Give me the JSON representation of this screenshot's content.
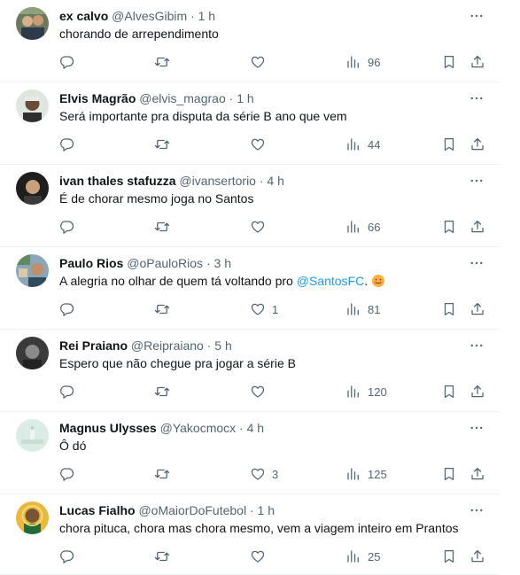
{
  "tweets": [
    {
      "name": "ex calvo",
      "handle": "@AlvesGibim",
      "time": "1 h",
      "text": "chorando de arrependimento",
      "mention": "",
      "text_after": "",
      "has_emoji": false,
      "replies": "",
      "retweets": "",
      "likes": "",
      "views": "96"
    },
    {
      "name": "Elvis Magrão",
      "handle": "@elvis_magrao",
      "time": "1 h",
      "text": "Será importante pra disputa da série B ano que vem",
      "mention": "",
      "text_after": "",
      "has_emoji": false,
      "replies": "",
      "retweets": "",
      "likes": "",
      "views": "44"
    },
    {
      "name": "ivan thales stafuzza",
      "handle": "@ivansertorio",
      "time": "4 h",
      "text": "É de chorar mesmo joga no Santos",
      "mention": "",
      "text_after": "",
      "has_emoji": false,
      "replies": "",
      "retweets": "",
      "likes": "",
      "views": "66"
    },
    {
      "name": "Paulo Rios",
      "handle": "@oPauloRios",
      "time": "3 h",
      "text": "A alegria no olhar de quem tá voltando pro ",
      "mention": "@SantosFC",
      "text_after": ".",
      "has_emoji": true,
      "replies": "",
      "retweets": "",
      "likes": "1",
      "views": "81"
    },
    {
      "name": "Rei Praiano",
      "handle": "@Reipraiano",
      "time": "5 h",
      "text": "Espero que não chegue pra jogar a série B",
      "mention": "",
      "text_after": "",
      "has_emoji": false,
      "replies": "",
      "retweets": "",
      "likes": "",
      "views": "120"
    },
    {
      "name": "Magnus Ulysses",
      "handle": "@Yakocmocx",
      "time": "4 h",
      "text": "Ô dó",
      "mention": "",
      "text_after": "",
      "has_emoji": false,
      "replies": "",
      "retweets": "",
      "likes": "3",
      "views": "125"
    },
    {
      "name": "Lucas Fialho",
      "handle": "@oMaiorDoFutebol",
      "time": "1 h",
      "text": "chora pituca, chora mas chora mesmo, vem a viagem inteiro em Prantos",
      "mention": "",
      "text_after": "",
      "has_emoji": false,
      "replies": "",
      "retweets": "",
      "likes": "",
      "views": "25"
    }
  ],
  "separator": "·",
  "icons": {
    "more": "more-dots-icon",
    "reply": "reply-icon",
    "retweet": "retweet-icon",
    "like": "heart-icon",
    "views": "views-chart-icon",
    "bookmark": "bookmark-icon",
    "share": "share-icon",
    "emoji": "smiling-face-emoji"
  },
  "colors": {
    "text": "#0f1419",
    "secondary": "#536471",
    "mention": "#1d9bf0",
    "divider": "#eff3f4"
  }
}
